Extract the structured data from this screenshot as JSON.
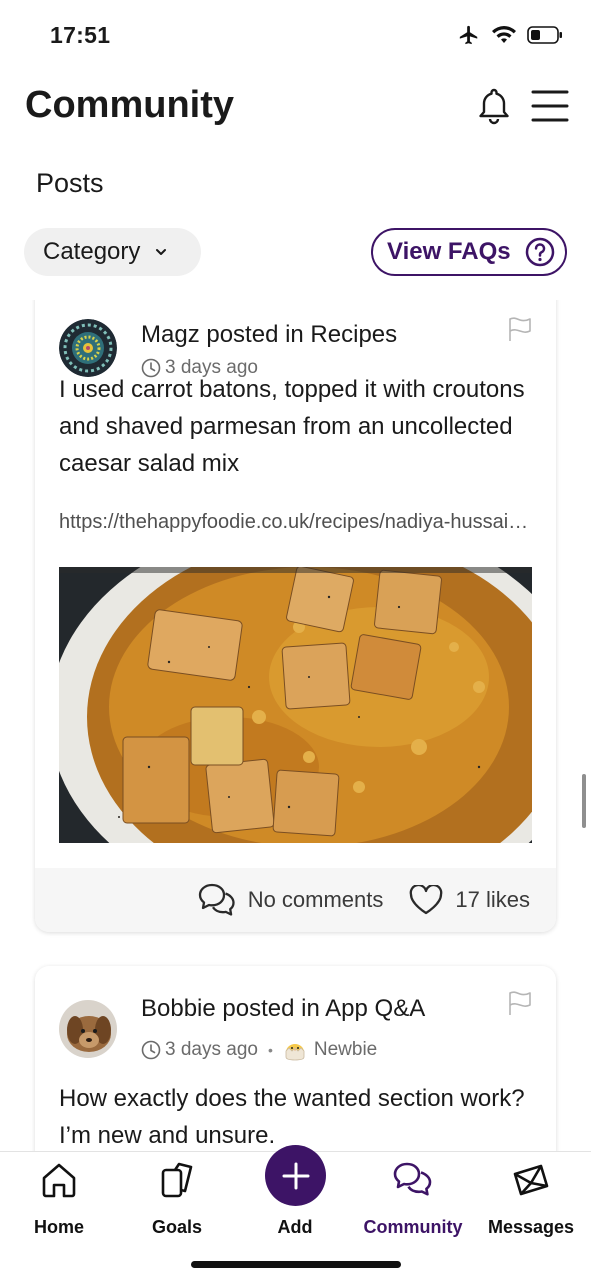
{
  "status": {
    "time": "17:51"
  },
  "header": {
    "title": "Community"
  },
  "section_title": "Posts",
  "filters": {
    "category_label": "Category",
    "faq_label": "View FAQs"
  },
  "posts": [
    {
      "author_line": "Magz posted in Recipes",
      "time_ago": "3 days ago",
      "body": "I used carrot batons, topped it with croutons and shaved parmesan from an uncollected caesar salad mix",
      "link": "https://thehappyfoodie.co.uk/recipes/nadiya-hussain-curried-carrot-soup",
      "comments_label": "No comments",
      "likes_label": "17 likes"
    },
    {
      "author_line": "Bobbie posted in App Q&A",
      "time_ago": "3 days ago",
      "badge": "Newbie",
      "body": "How exactly does the wanted section work? I’m new and unsure."
    }
  ],
  "nav": {
    "items": [
      {
        "label": "Home",
        "icon": "home-icon"
      },
      {
        "label": "Goals",
        "icon": "goals-icon"
      },
      {
        "label": "Add",
        "icon": "plus-icon"
      },
      {
        "label": "Community",
        "icon": "chat-bubbles-icon"
      },
      {
        "label": "Messages",
        "icon": "envelope-icon"
      }
    ],
    "active": "Community"
  },
  "colors": {
    "brand": "#3d1466",
    "text": "#1a1a1a",
    "muted": "#6b6b6b"
  }
}
